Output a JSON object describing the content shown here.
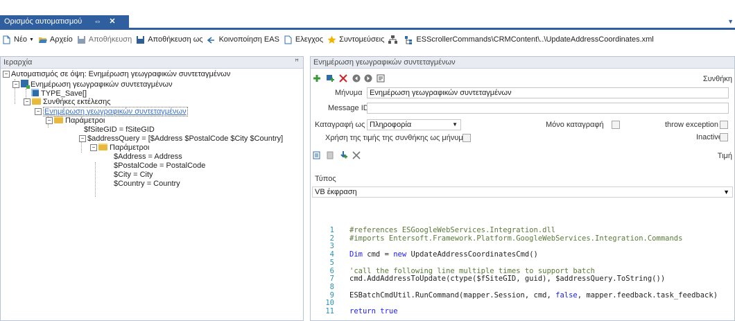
{
  "tab": {
    "title": "Ορισμός αυτοματισμού",
    "pin": "⇔",
    "close": "✕"
  },
  "toolbar": {
    "new_label": "Νέο",
    "file_label": "Αρχείο",
    "save_label": "Αποθήκευση",
    "save_as_label": "Αποθήκευση ως",
    "share_label": "Κοινοποίηση EAS",
    "check_label": "Ελεγχος",
    "shortcuts_label": "Συντομεύσεις",
    "path_label": "ESScrollerCommands\\CRMContent\\..\\UpdateAddressCoordinates.xml"
  },
  "left_panel": {
    "title": "Ιεραρχία",
    "pin": "ꟸ",
    "tree": [
      "Αυτοματισμός σε όψη: Ενημέρωση γεωγραφικών συντεταγμένων",
      "Ενημέρωση γεωγραφικών συντεταγμένων",
      "TYPE_Save[]",
      "Συνθήκες εκτέλεσης",
      "Ενημέρωση γεωγραφικών συντεταγμένων",
      "Παράμετροι",
      "$fSiteGID = fSiteGID",
      "$addressQuery = [$Address $PostalCode $City $Country]",
      "Παράμετροι",
      "$Address = Address",
      "$PostalCode = PostalCode",
      "$City = City",
      "$Country = Country"
    ]
  },
  "right_panel": {
    "title": "Ενημέρωση γεωγραφικών συντεταγμένων",
    "condition_label": "Συνθήκη",
    "message_label": "Μήνυμα",
    "message_value": "Ενημέρωση γεωγραφικών συντεταγμένων",
    "message_id_label": "Message ID",
    "message_id_value": "",
    "log_as_label": "Καταγραφή ως",
    "log_as_value": "Πληροφορία",
    "log_only_label": "Μόνο καταγραφή",
    "throw_label": "throw exception",
    "use_condition_label": "Χρήση της τιμής της συνθήκης ως μήνυμα",
    "inactive_label": "Inactive",
    "value_label": "Τιμή",
    "type_label": "Τύπος",
    "type_value": "VB έκφραση"
  },
  "code": {
    "line_numbers": [
      "1",
      "2",
      "3",
      "4",
      "5",
      "6",
      "7",
      "8",
      "9",
      "10",
      "11"
    ],
    "lines": [
      "#references ESGoogleWebServices.Integration.dll",
      "#imports Entersoft.Framework.Platform.GoogleWebServices.Integration.Commands",
      "",
      "Dim cmd = new UpdateAddressCoordinatesCmd()",
      "",
      "'call the following line multiple times to support batch",
      "cmd.AddAddressToUpdate(ctype($fSiteGID, guid), $addressQuery.ToString())",
      "",
      "ESBatchCmdUtil.RunCommand(mapper.Session, cmd, false, mapper.feedback.task_feedback)",
      "",
      "return true"
    ]
  }
}
